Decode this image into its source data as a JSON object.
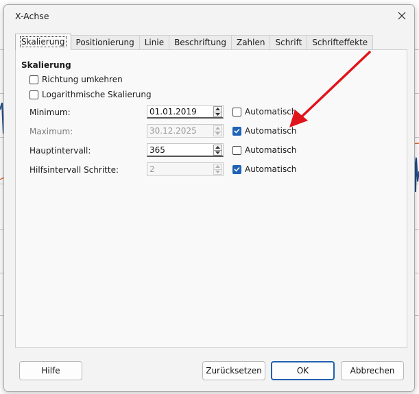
{
  "dialog": {
    "title": "X-Achse"
  },
  "tabs": [
    {
      "label": "Skalierung",
      "active": true
    },
    {
      "label": "Positionierung",
      "active": false
    },
    {
      "label": "Linie",
      "active": false
    },
    {
      "label": "Beschriftung",
      "active": false
    },
    {
      "label": "Zahlen",
      "active": false
    },
    {
      "label": "Schrift",
      "active": false
    },
    {
      "label": "Schrifteffekte",
      "active": false
    }
  ],
  "scaling": {
    "section_title": "Skalierung",
    "reverse_direction": {
      "label": "Richtung umkehren",
      "checked": false
    },
    "logarithmic": {
      "label": "Logarithmische Skalierung",
      "checked": false
    },
    "fields": [
      {
        "label": "Minimum:",
        "value": "01.01.2019",
        "enabled": true,
        "auto_label": "Automatisch",
        "auto_checked": false
      },
      {
        "label": "Maximum:",
        "value": "30.12.2025",
        "enabled": false,
        "auto_label": "Automatisch",
        "auto_checked": true
      },
      {
        "label": "Hauptintervall:",
        "value": "365",
        "enabled": true,
        "auto_label": "Automatisch",
        "auto_checked": false
      },
      {
        "label": "Hilfsintervall Schritte:",
        "value": "2",
        "enabled": false,
        "auto_label": "Automatisch",
        "auto_checked": true
      }
    ]
  },
  "buttons": {
    "help": "Hilfe",
    "reset": "Zurücksetzen",
    "ok": "OK",
    "cancel": "Abbrechen"
  },
  "colors": {
    "accent": "#1e63b6",
    "annotation_arrow": "#e0141b",
    "chart_series_blue": "#1f4e8c",
    "chart_series_orange": "#e0662a"
  },
  "icons": {
    "close": "close-icon",
    "checkbox_checked": "checkmark-icon",
    "spin_up": "chevron-up-icon",
    "spin_down": "chevron-down-icon",
    "annotation": "red-arrow-icon"
  }
}
